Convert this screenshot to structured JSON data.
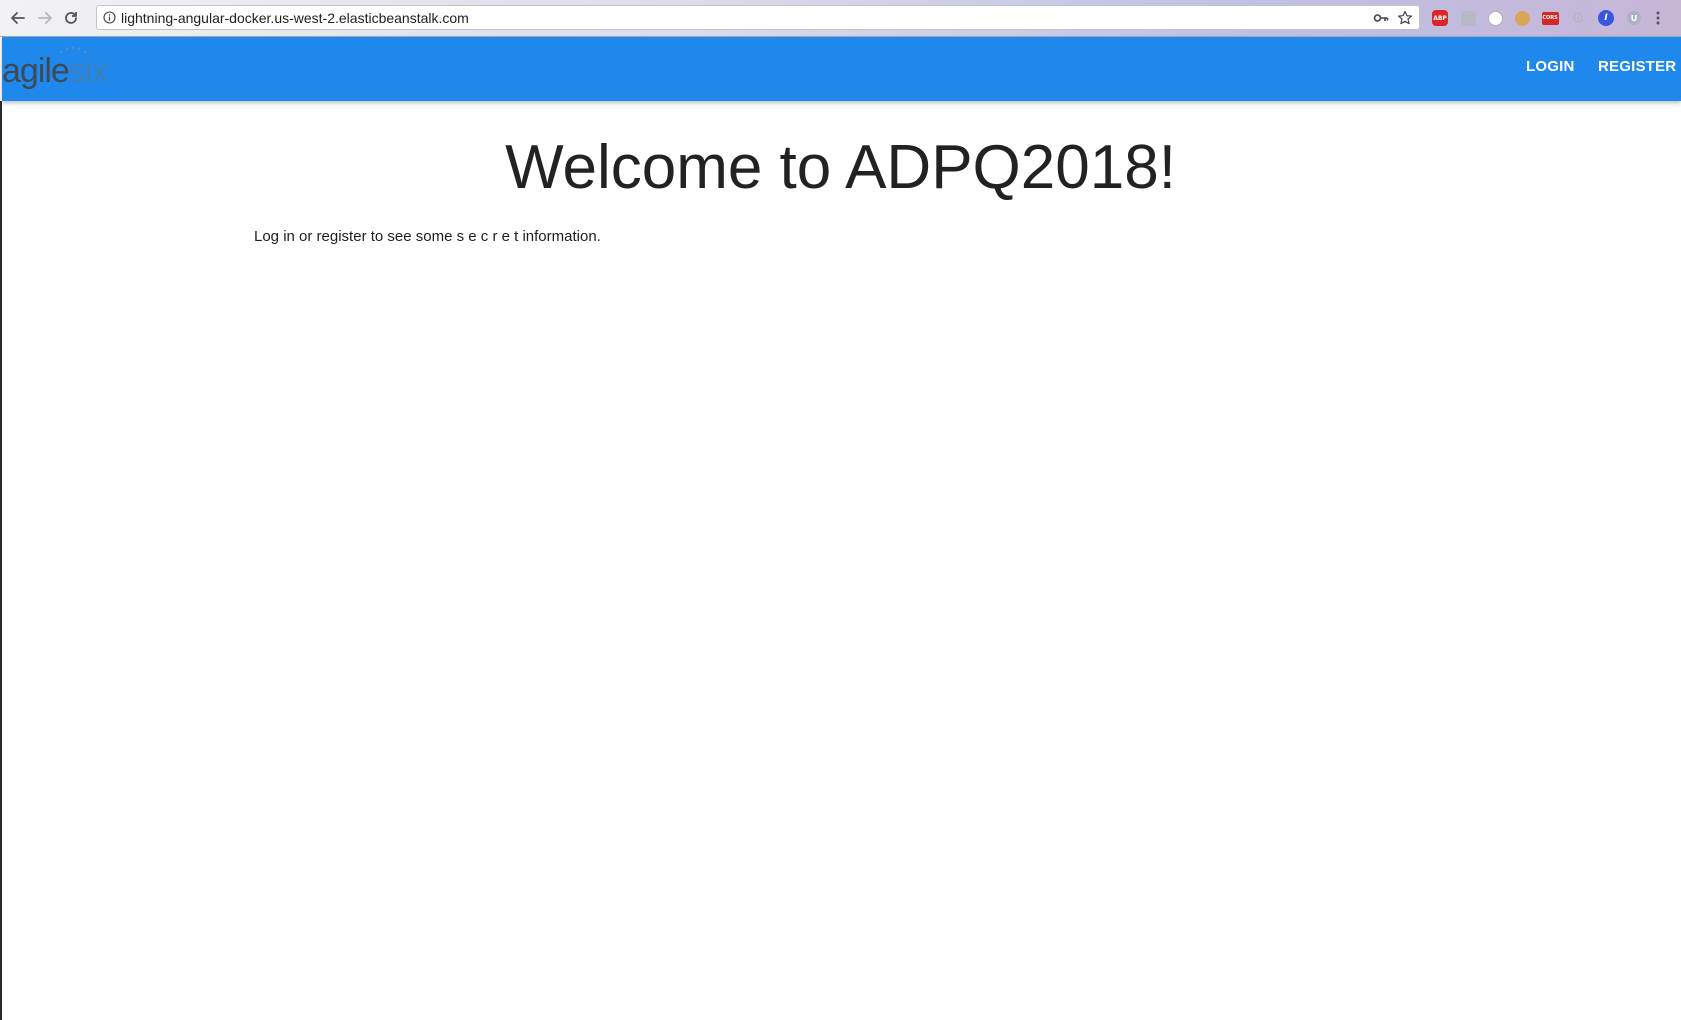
{
  "browser": {
    "url": "lightning-angular-docker.us-west-2.elasticbeanstalk.com",
    "extensions": {
      "abp_label": "ABP",
      "cors_label": "CORS"
    }
  },
  "header": {
    "logo": {
      "part1": "agile",
      "part2": "six"
    },
    "nav": {
      "login_label": "LOGIN",
      "register_label": "REGISTER"
    },
    "background_color": "#1e88ec"
  },
  "main": {
    "title": "Welcome to ADPQ2018!",
    "intro": "Log in or register to see some s e c r e t information."
  },
  "icons": [
    "back-arrow-icon",
    "forward-arrow-icon",
    "reload-icon",
    "info-icon",
    "key-icon",
    "star-icon",
    "adblock-icon",
    "notepad-icon",
    "circle-extension-icon",
    "cookie-icon",
    "cors-icon",
    "gear-icon",
    "blue-extension-icon",
    "grey-extension-icon",
    "kebab-menu-icon"
  ]
}
